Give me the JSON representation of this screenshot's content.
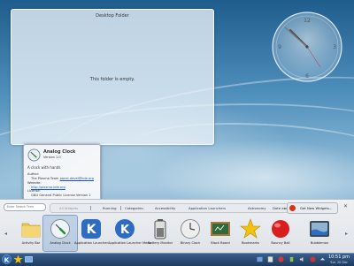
{
  "desktop_folder": {
    "title": "Desktop Folder",
    "empty_message": "This folder is empty."
  },
  "analog_clock_numbers": {
    "twelve": "12",
    "three": "3",
    "six": "6",
    "nine": "9"
  },
  "tooltip": {
    "name": "Analog Clock",
    "version": "Version 1.0",
    "description": "A clock with hands",
    "author_label": "Author:",
    "author_value": "The Plasma Team",
    "author_email": "panel-devel@kde.org",
    "website_label": "Website:",
    "website_value": "http://plasma.kde.org",
    "license_label": "License:",
    "license_value": "GNU General Public License Version 2"
  },
  "add_widgets": {
    "search_placeholder": "Enter Search Term",
    "categories": [
      {
        "label": "All Widgets",
        "active": true
      },
      {
        "label": "Running",
        "active": false
      },
      {
        "label": "Categories:",
        "active": false
      },
      {
        "label": "Accessibility",
        "active": false
      },
      {
        "label": "Application Launchers",
        "active": false
      },
      {
        "label": "Astronomy",
        "active": false
      },
      {
        "label": "Date and Time",
        "active": false
      }
    ],
    "get_new_label": "Get New Widgets...",
    "widgets": [
      {
        "label": "Activity Bar",
        "icon": "folder-icon"
      },
      {
        "label": "Analog Clock",
        "icon": "analog-clock-icon",
        "selected": true
      },
      {
        "label": "Application Launcher",
        "icon": "kde-launcher-icon"
      },
      {
        "label": "Application Launcher Menu",
        "icon": "kde-launcher-menu-icon"
      },
      {
        "label": "Battery Monitor",
        "icon": "battery-icon"
      },
      {
        "label": "Binary Clock",
        "icon": "binary-clock-icon"
      },
      {
        "label": "Black Board",
        "icon": "blackboard-icon"
      },
      {
        "label": "Bookmarks",
        "icon": "star-icon"
      },
      {
        "label": "Bouncy Ball",
        "icon": "ball-icon"
      },
      {
        "label": "Bubblemon",
        "icon": "bubblemon-icon"
      }
    ]
  },
  "taskbar": {
    "time": "10:51 pm",
    "date": "Tue, 20 Dec"
  },
  "colors": {
    "taskbar": "#1d3b60",
    "link": "#1a55b5",
    "kde_blue": "#2d6cc0"
  }
}
